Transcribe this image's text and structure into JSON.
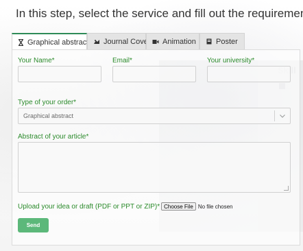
{
  "heading": "In this step, select the service and fill out the requirements",
  "tabs": [
    {
      "label": "Graphical abstract",
      "icon": "hourglass-icon",
      "active": true
    },
    {
      "label": "Journal Cover",
      "icon": "cover-icon",
      "active": false
    },
    {
      "label": "Animation",
      "icon": "video-camera-icon",
      "active": false
    },
    {
      "label": "Poster",
      "icon": "poster-icon",
      "active": false
    }
  ],
  "form": {
    "name_label": "Your Name*",
    "name_value": "",
    "email_label": "Email*",
    "email_value": "",
    "university_label": "Your university*",
    "university_value": "",
    "order_type_label": "Type of your order*",
    "order_type_value": "Graphical abstract",
    "abstract_label": "Abstract of your article*",
    "abstract_value": "",
    "upload_label": "Upload your idea or draft (PDF or PPT or ZIP)*",
    "choose_file_label": "Choose File",
    "no_file_text": "No file chosen",
    "send_label": "Send"
  },
  "colors": {
    "label_green": "#2a8a2a",
    "send_button": "#5cb87a",
    "active_tab_border": "#2e8b57"
  }
}
